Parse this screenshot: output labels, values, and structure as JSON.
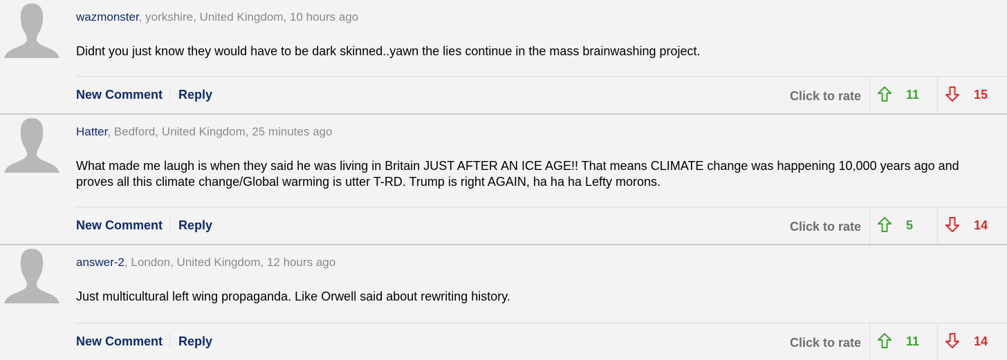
{
  "colors": {
    "username": "#0e2b6b",
    "meta": "#8a8a8a",
    "link": "#0e2b6b",
    "rate_label": "#6e6e6e",
    "upvote": "#3aa52f",
    "downvote": "#e02626",
    "background": "#f3f3f3"
  },
  "icons": {
    "avatar": "default-user-silhouette-icon",
    "upvote": "arrow-up-outline-icon",
    "downvote": "arrow-down-outline-icon"
  },
  "comments": [
    {
      "username": "wazmonster",
      "location_time": ", yorkshire, United Kingdom, 10 hours ago",
      "text": "Didnt you just know they would have to be dark skinned..yawn the lies continue in the mass brainwashing project.",
      "new_comment_label": "New Comment",
      "reply_label": "Reply",
      "rate_label": "Click to rate",
      "upvotes": "11",
      "downvotes": "15"
    },
    {
      "username": "Hatter",
      "location_time": ", Bedford, United Kingdom, 25 minutes ago",
      "text": "What made me laugh is when they said he was living in Britain JUST AFTER AN ICE AGE!! That means CLIMATE change was happening 10,000 years ago and proves all this climate change/Global warming is utter T-RD. Trump is right AGAIN, ha ha ha Lefty morons.",
      "new_comment_label": "New Comment",
      "reply_label": "Reply",
      "rate_label": "Click to rate",
      "upvotes": "5",
      "downvotes": "14"
    },
    {
      "username": "answer-2",
      "location_time": ", London, United Kingdom, 12 hours ago",
      "text": "Just multicultural left wing propaganda. Like Orwell said about rewriting history.",
      "new_comment_label": "New Comment",
      "reply_label": "Reply",
      "rate_label": "Click to rate",
      "upvotes": "11",
      "downvotes": "14"
    }
  ]
}
